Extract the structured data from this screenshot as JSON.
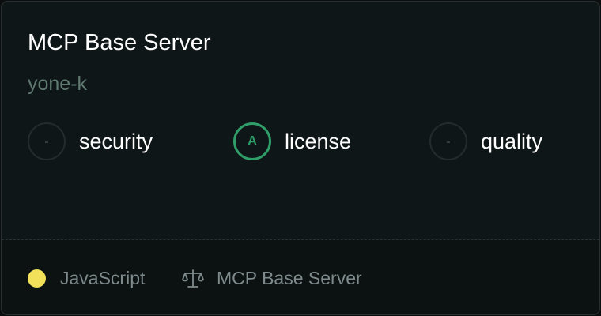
{
  "card": {
    "title": "MCP Base Server",
    "author": "yone-k"
  },
  "scores": [
    {
      "grade": "-",
      "label": "security",
      "graded": false
    },
    {
      "grade": "A",
      "label": "license",
      "graded": true
    },
    {
      "grade": "-",
      "label": "quality",
      "graded": false
    }
  ],
  "footer": {
    "language": "JavaScript",
    "language_color": "#f1e05a",
    "license_icon": "scale-icon",
    "license_name": "MCP Base Server"
  },
  "colors": {
    "grade_accent": "#2f9e68",
    "background": "#0f1618"
  }
}
